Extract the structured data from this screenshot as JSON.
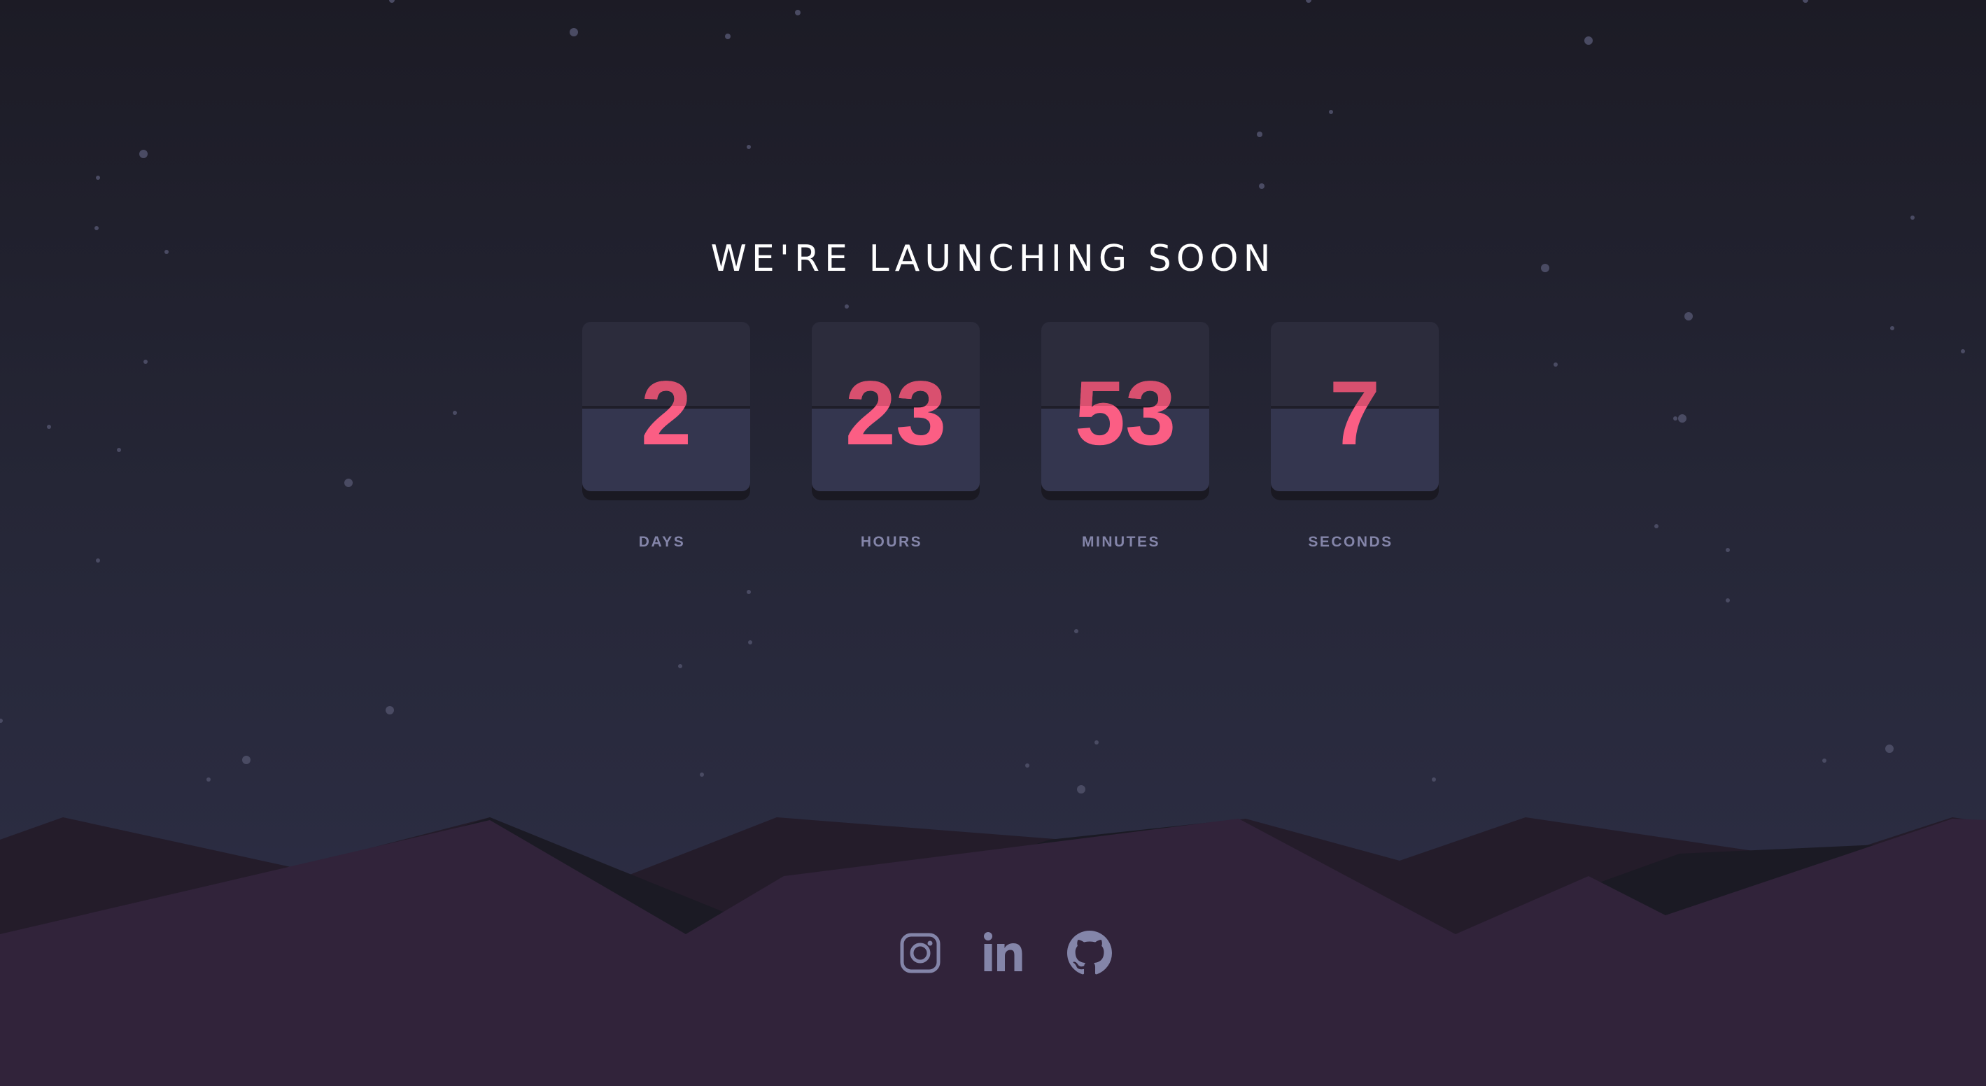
{
  "title": "WE'RE LAUNCHING SOON",
  "countdown": [
    {
      "value": "2",
      "label": "DAYS"
    },
    {
      "value": "23",
      "label": "HOURS"
    },
    {
      "value": "53",
      "label": "MINUTES"
    },
    {
      "value": "7",
      "label": "SECONDS"
    }
  ],
  "social": [
    {
      "icon": "instagram-icon"
    },
    {
      "icon": "linkedin-icon"
    },
    {
      "icon": "github-icon"
    }
  ],
  "colors": {
    "accent": "#fb5e84",
    "label": "#8485a9",
    "card_top": "#2c2c3c",
    "card_bottom": "#34364f",
    "hills_front": "#31233a",
    "icon": "#8485a9"
  }
}
